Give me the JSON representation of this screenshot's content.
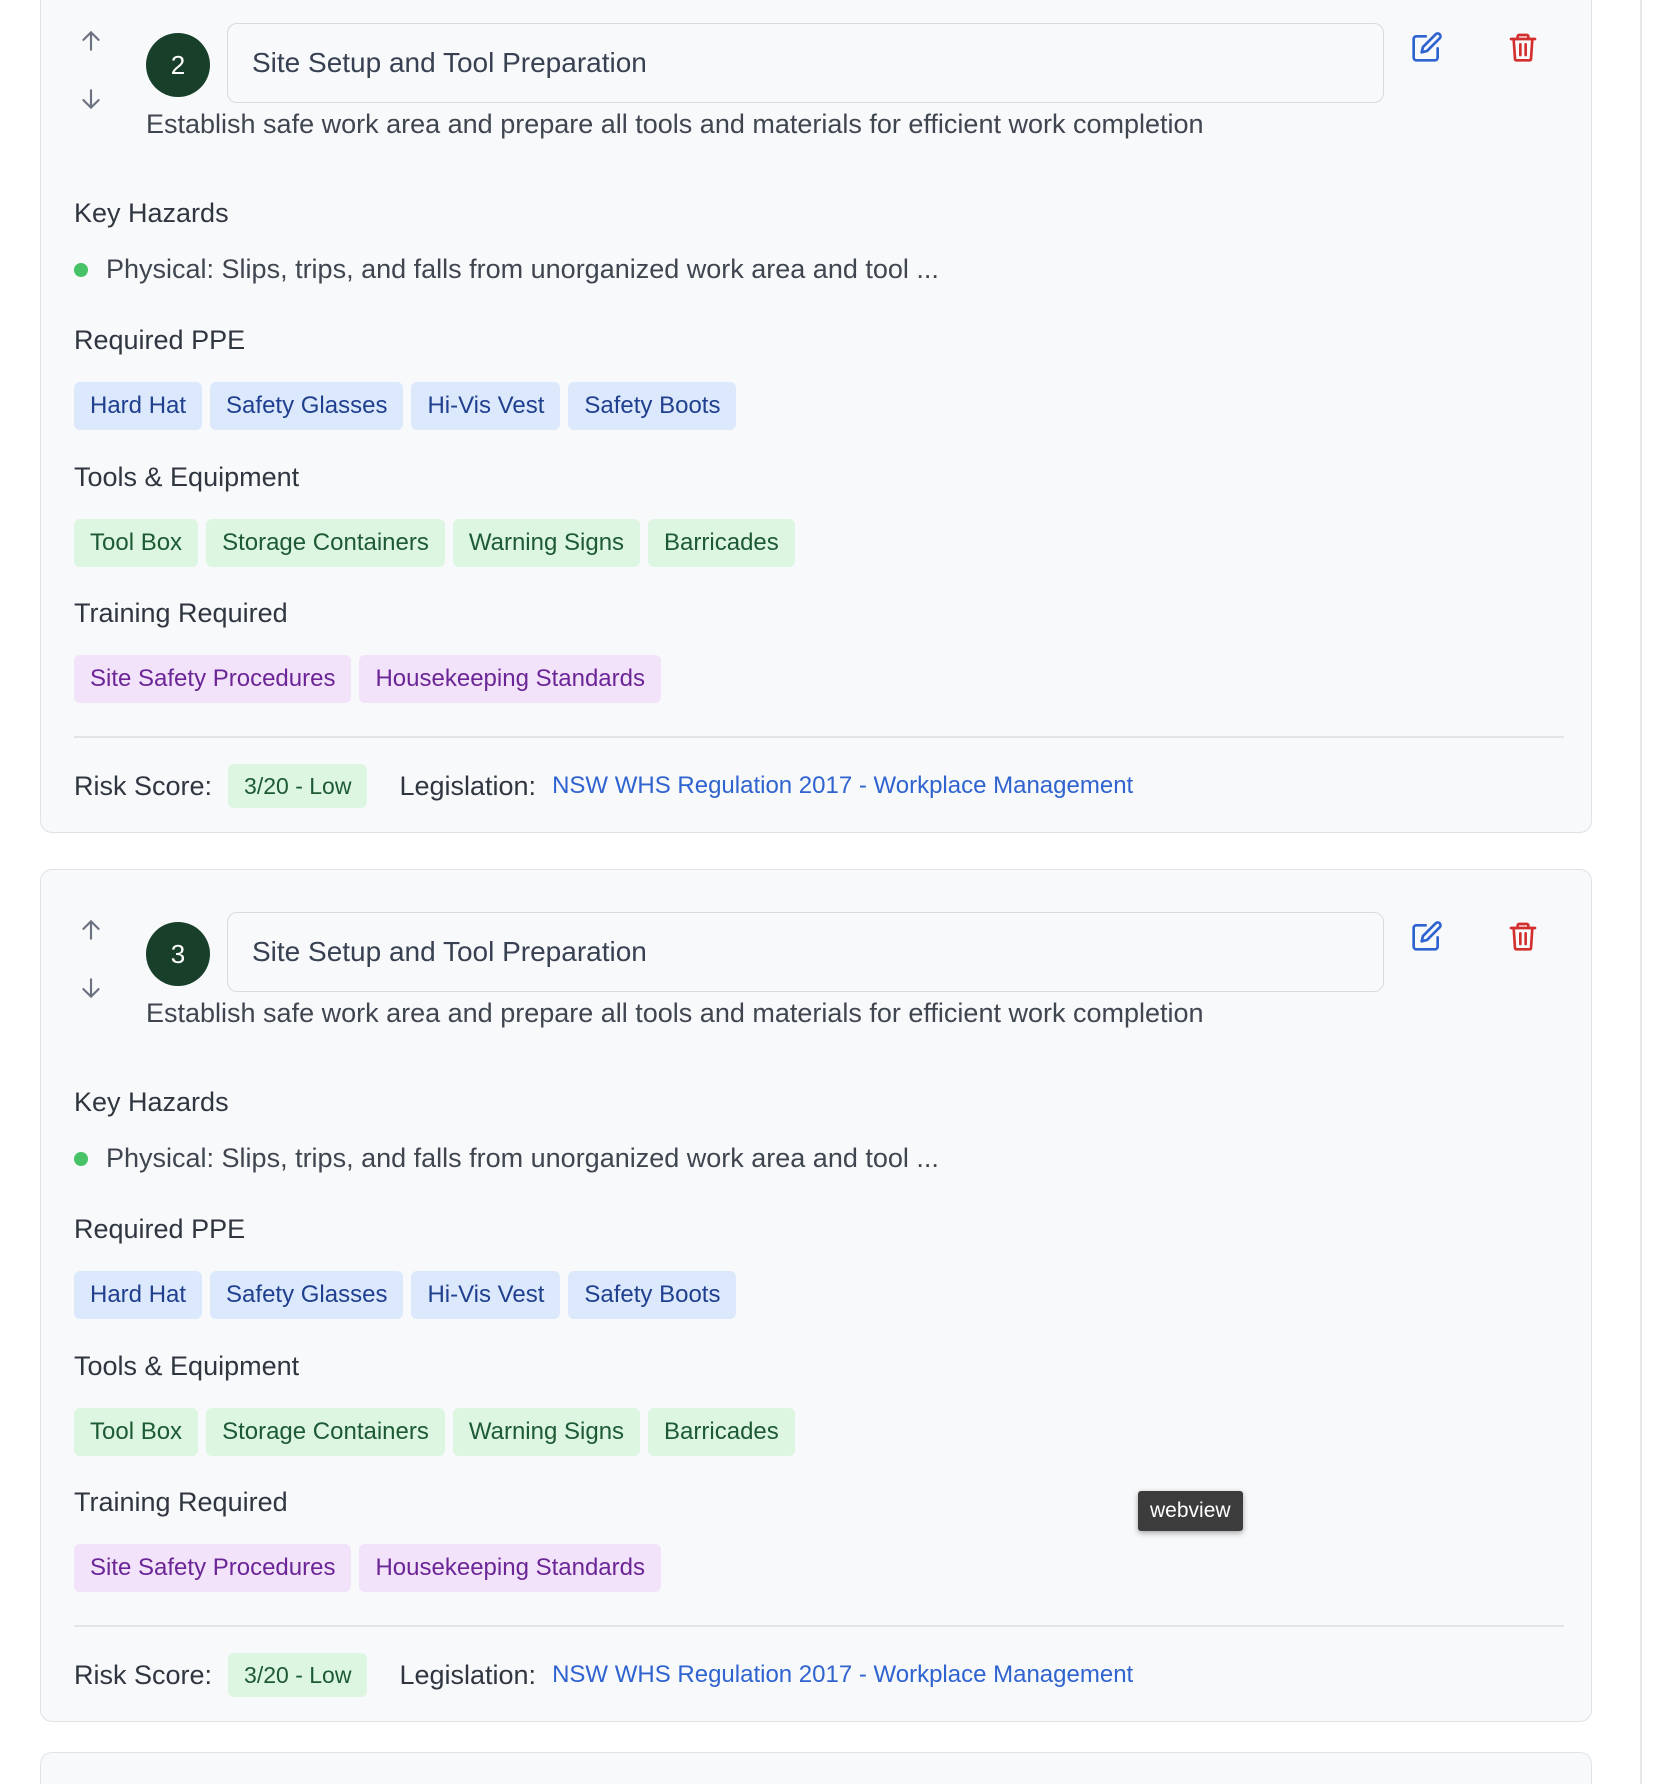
{
  "steps": [
    {
      "number": "2",
      "title": "Site Setup and Tool Preparation",
      "description": "Establish safe work area and prepare all tools and materials for efficient work completion",
      "hazards_heading": "Key Hazards",
      "hazards": [
        "Physical: Slips, trips, and falls from unorganized work area and tool ..."
      ],
      "ppe_heading": "Required PPE",
      "ppe": [
        "Hard Hat",
        "Safety Glasses",
        "Hi-Vis Vest",
        "Safety Boots"
      ],
      "tools_heading": "Tools & Equipment",
      "tools": [
        "Tool Box",
        "Storage Containers",
        "Warning Signs",
        "Barricades"
      ],
      "training_heading": "Training Required",
      "training": [
        "Site Safety Procedures",
        "Housekeeping Standards"
      ],
      "risk_label": "Risk Score:",
      "risk_value": "3/20 - Low",
      "legislation_label": "Legislation:",
      "legislation_link": "NSW WHS Regulation 2017 - Workplace Management"
    },
    {
      "number": "3",
      "title": "Site Setup and Tool Preparation",
      "description": "Establish safe work area and prepare all tools and materials for efficient work completion",
      "hazards_heading": "Key Hazards",
      "hazards": [
        "Physical: Slips, trips, and falls from unorganized work area and tool ..."
      ],
      "ppe_heading": "Required PPE",
      "ppe": [
        "Hard Hat",
        "Safety Glasses",
        "Hi-Vis Vest",
        "Safety Boots"
      ],
      "tools_heading": "Tools & Equipment",
      "tools": [
        "Tool Box",
        "Storage Containers",
        "Warning Signs",
        "Barricades"
      ],
      "training_heading": "Training Required",
      "training": [
        "Site Safety Procedures",
        "Housekeeping Standards"
      ],
      "risk_label": "Risk Score:",
      "risk_value": "3/20 - Low",
      "legislation_label": "Legislation:",
      "legislation_link": "NSW WHS Regulation 2017 - Workplace Management"
    }
  ],
  "tooltip": "webview",
  "icons": {
    "move_up": "arrow-up-icon",
    "move_down": "arrow-down-icon",
    "edit": "edit-icon",
    "delete": "trash-icon",
    "hazard_marker": "dot-icon"
  },
  "colors": {
    "step_badge": "#173f2a",
    "hazard_dot": "#47c266",
    "ppe_tag": "#dce8fb",
    "tool_tag": "#dcf6e2",
    "training_tag": "#f2e3fa",
    "edit_icon": "#2f63cf",
    "delete_icon": "#d32f2f",
    "link": "#2f63cf"
  }
}
